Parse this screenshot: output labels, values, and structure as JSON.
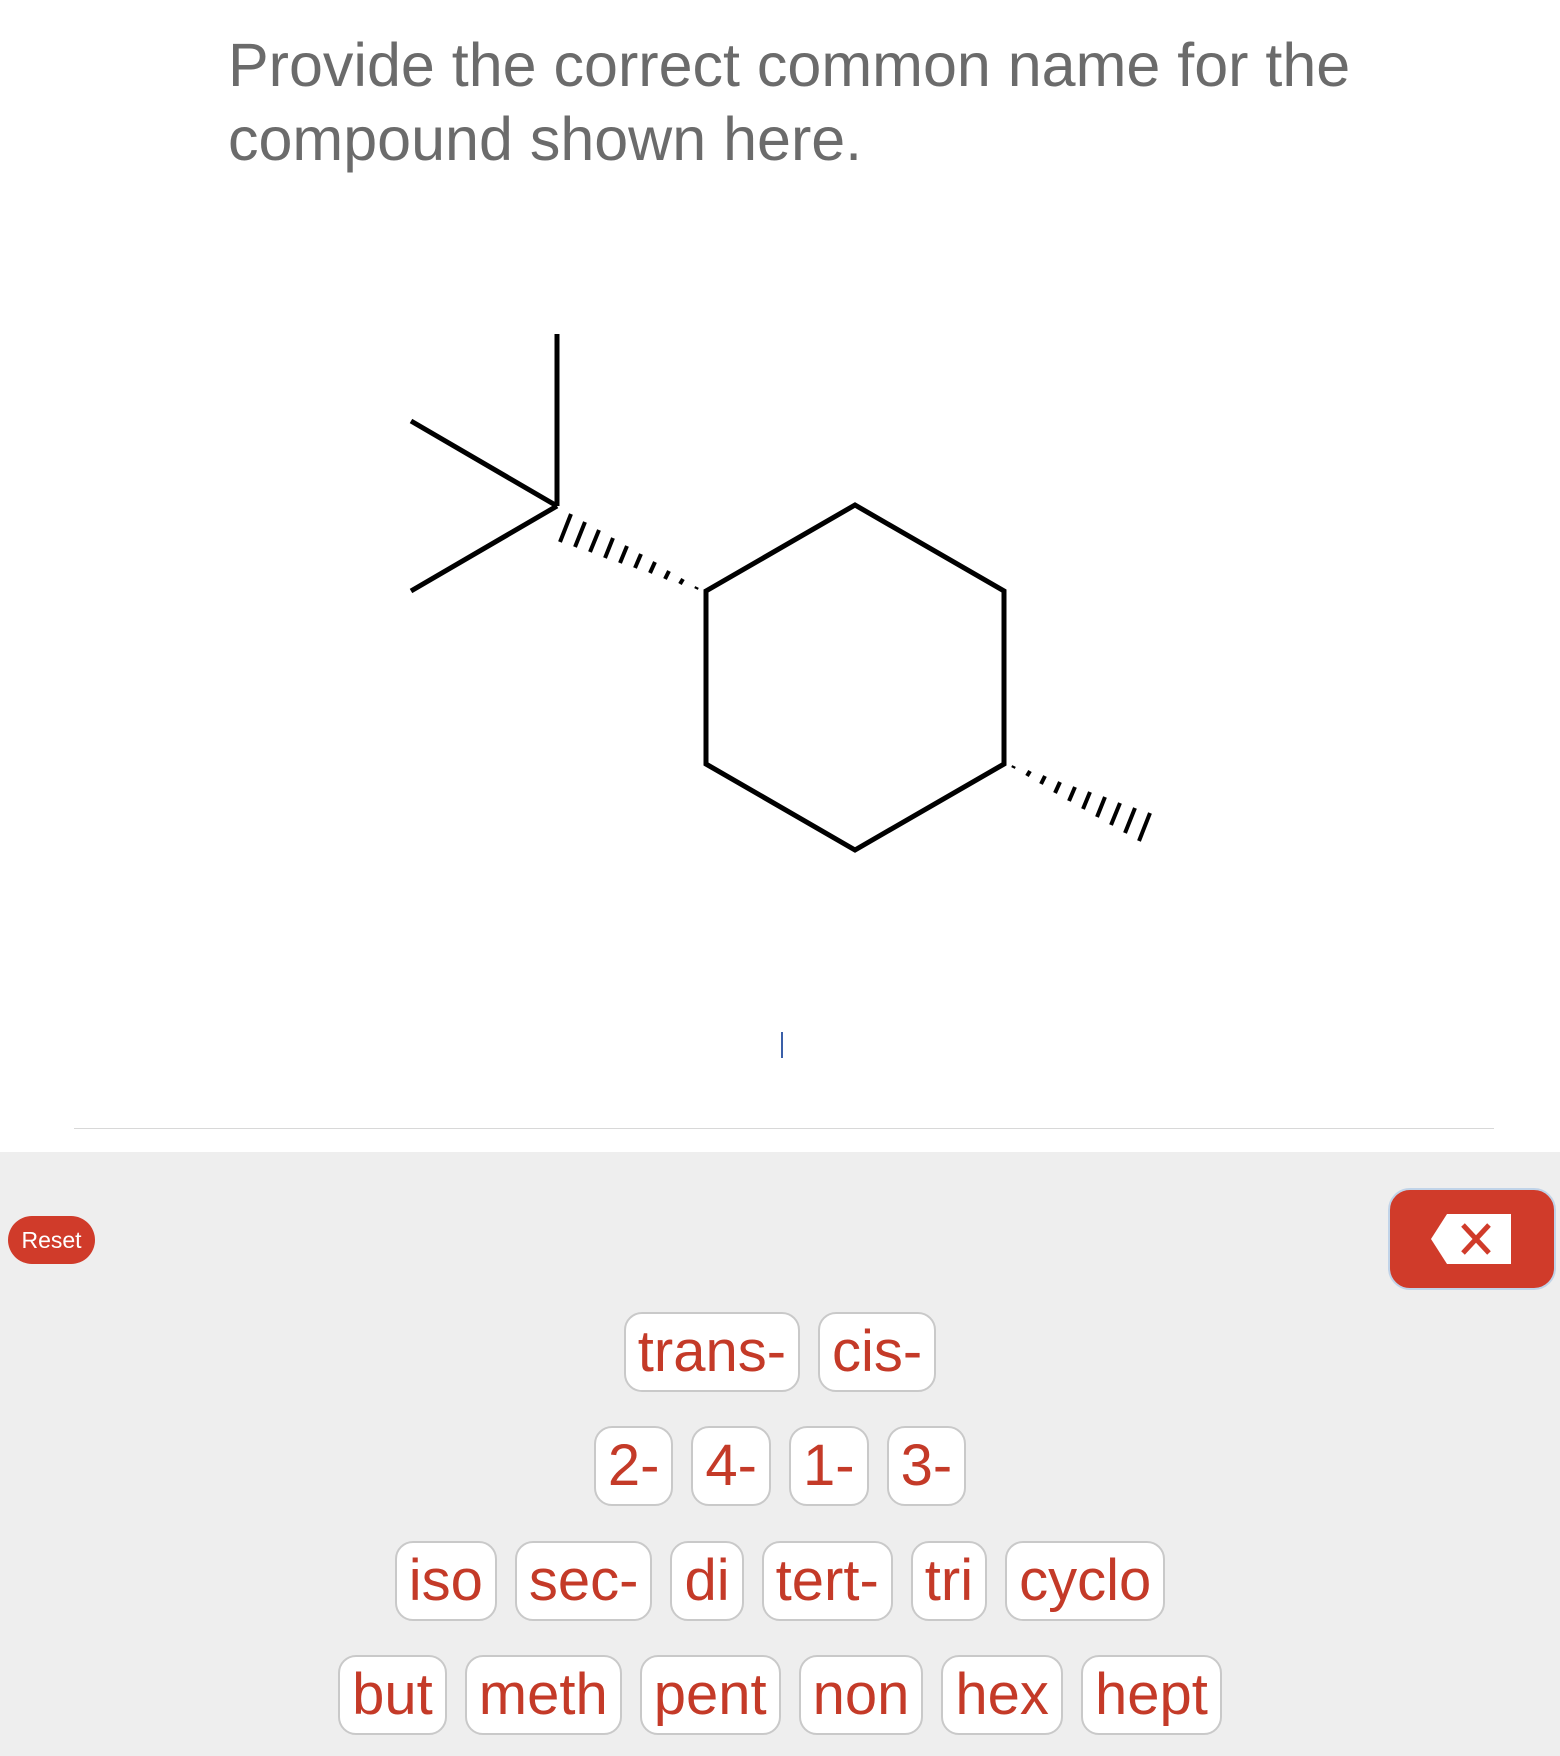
{
  "question": {
    "text_line1": "Provide the correct common name for the",
    "text_line2": "compound shown here."
  },
  "molecule": {
    "description_icon": "trans-1-tert-butyl-4-methylcyclohexane-structure-icon"
  },
  "answer": {
    "value": ""
  },
  "controls": {
    "reset_label": "Reset",
    "backspace_icon": "backspace-icon"
  },
  "keys": {
    "row1": [
      "trans-",
      "cis-"
    ],
    "row2": [
      "2-",
      "4-",
      "1-",
      "3-"
    ],
    "row3": [
      "iso",
      "sec-",
      "di",
      "tert-",
      "tri",
      "cyclo"
    ],
    "row4": [
      "but",
      "meth",
      "pent",
      "non",
      "hex",
      "hept"
    ]
  },
  "colors": {
    "accent": "#d03b2a",
    "key_text": "#c43a28",
    "keyboard_bg": "#eeeeee",
    "question_text": "#6b6b6b"
  }
}
